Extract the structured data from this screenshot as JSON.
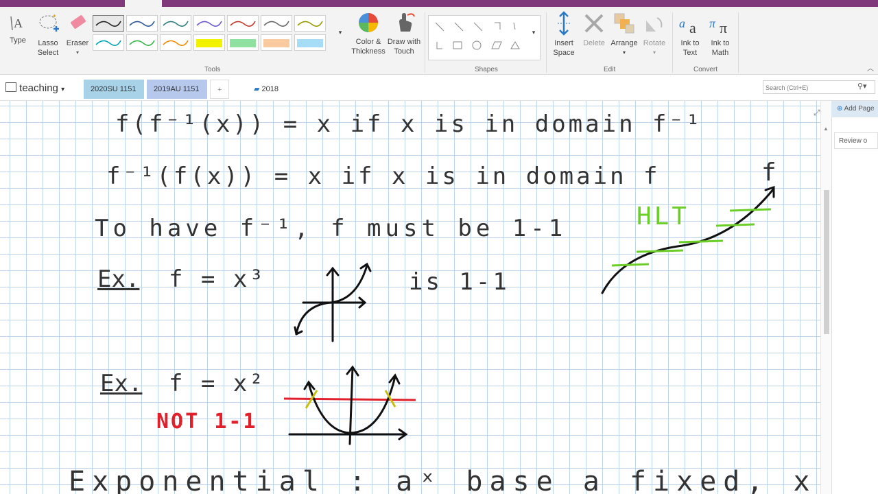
{
  "ribbon": {
    "groups": {
      "tools": "Tools",
      "shapes": "Shapes",
      "edit": "Edit",
      "convert": "Convert"
    },
    "buttons": {
      "type": "Type",
      "lasso": [
        "Lasso",
        "Select"
      ],
      "eraser": "Eraser",
      "color": [
        "Color &",
        "Thickness"
      ],
      "draw": [
        "Draw with",
        "Touch"
      ],
      "insert": [
        "Insert",
        "Space"
      ],
      "delete": "Delete",
      "arrange": "Arrange",
      "rotate": "Rotate",
      "inktext": [
        "Ink to",
        "Text"
      ],
      "inkmath": [
        "Ink to",
        "Math"
      ]
    },
    "pen_colors": [
      "#222222",
      "#2b5797",
      "#2e7d7d",
      "#6a5acd",
      "#c0392b",
      "#666666",
      "#9a9a00",
      "#00a6b4",
      "#39b54a",
      "#f08c00",
      "#f2f200",
      "#90e0a0",
      "#f9c9a0",
      "#a6dcf5"
    ]
  },
  "notebook": {
    "name": "teaching",
    "sections": [
      "2020SU 1151",
      "2019AU 1151",
      "+",
      "2018"
    ],
    "section_colors": [
      "#a8d2e8",
      "#b6c8ec"
    ]
  },
  "search": {
    "placeholder": "Search (Ctrl+E)"
  },
  "pages": {
    "add": "Add Page",
    "item": "Review o"
  },
  "ink": {
    "line1": "f(f⁻¹(x)) = x if x is in domain f⁻¹",
    "line2": "f⁻¹(f(x)) = x if x is in domain f",
    "line3": "To have f⁻¹, f must be 1-1",
    "ex1_label": "Ex.",
    "ex1_eq": "f = x³",
    "ex1_result": "is 1-1",
    "ex2_label": "Ex.",
    "ex2_eq": "f = x²",
    "ex2_result": "NOT 1-1",
    "hlt": "HLT",
    "f_label": "f",
    "bottom": "Exponential : aˣ base a fixed, x the v"
  },
  "colors": {
    "ink": "#111111",
    "red": "#e0202a",
    "green": "#6ccf28",
    "olive": "#c8c010",
    "accent": "#80397b"
  }
}
